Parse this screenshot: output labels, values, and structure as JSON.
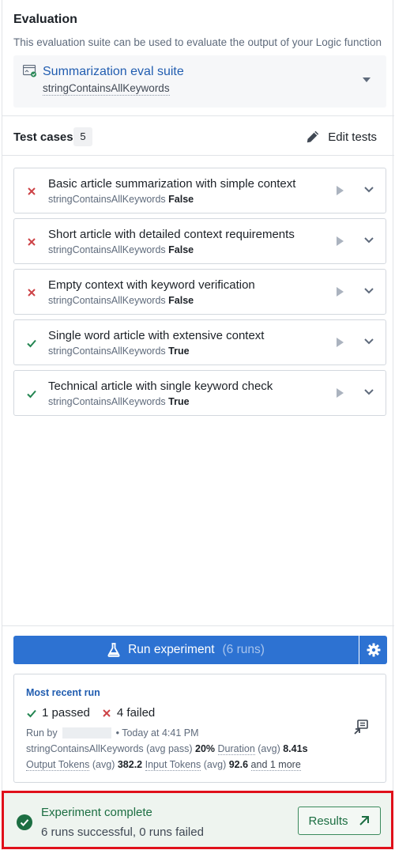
{
  "evaluation": {
    "title": "Evaluation",
    "description": "This evaluation suite can be used to evaluate the output of your Logic function",
    "suite_name": "Summarization eval suite",
    "suite_evaluator": "stringContainsAllKeywords"
  },
  "test_cases": {
    "label": "Test cases",
    "count": "5",
    "edit_label": "Edit tests",
    "items": [
      {
        "title": "Basic article summarization with simple context",
        "evaluator": "stringContainsAllKeywords",
        "result": "False",
        "status": "fail"
      },
      {
        "title": "Short article with detailed context requirements",
        "evaluator": "stringContainsAllKeywords",
        "result": "False",
        "status": "fail"
      },
      {
        "title": "Empty context with keyword verification",
        "evaluator": "stringContainsAllKeywords",
        "result": "False",
        "status": "fail"
      },
      {
        "title": "Single word article with extensive context",
        "evaluator": "stringContainsAllKeywords",
        "result": "True",
        "status": "pass"
      },
      {
        "title": "Technical article with single keyword check",
        "evaluator": "stringContainsAllKeywords",
        "result": "True",
        "status": "pass"
      }
    ]
  },
  "run_experiment": {
    "label": "Run experiment",
    "runs": "(6 runs)"
  },
  "recent_run": {
    "title": "Most recent run",
    "passed": "1 passed",
    "failed": "4 failed",
    "run_by_label": "Run by",
    "run_time": "• Today at 4:41 PM",
    "evaluator": "stringContainsAllKeywords",
    "avg_pass_label": "(avg pass)",
    "avg_pass_value": "20%",
    "duration_label": "Duration",
    "avg_label": "(avg)",
    "duration_value": "8.41s",
    "output_tokens_label": "Output Tokens",
    "output_tokens_value": "382.2",
    "input_tokens_label": "Input Tokens",
    "input_tokens_value": "92.6",
    "more_link": "and 1 more"
  },
  "toast": {
    "title": "Experiment complete",
    "subtitle": "6 runs successful, 0 runs failed",
    "button": "Results"
  },
  "colors": {
    "primary": "#2d72d2",
    "fail": "#cd4246",
    "pass": "#238551",
    "highlight_border": "#e0101a"
  },
  "icons": {
    "suite": "eval-suite-icon",
    "edit": "pencil-icon",
    "play": "play-icon",
    "expand": "chevron-down-icon",
    "run": "flask-icon",
    "settings": "gear-icon",
    "open": "open-panel-icon",
    "success": "check-circle-icon",
    "results": "arrow-top-right-icon"
  }
}
